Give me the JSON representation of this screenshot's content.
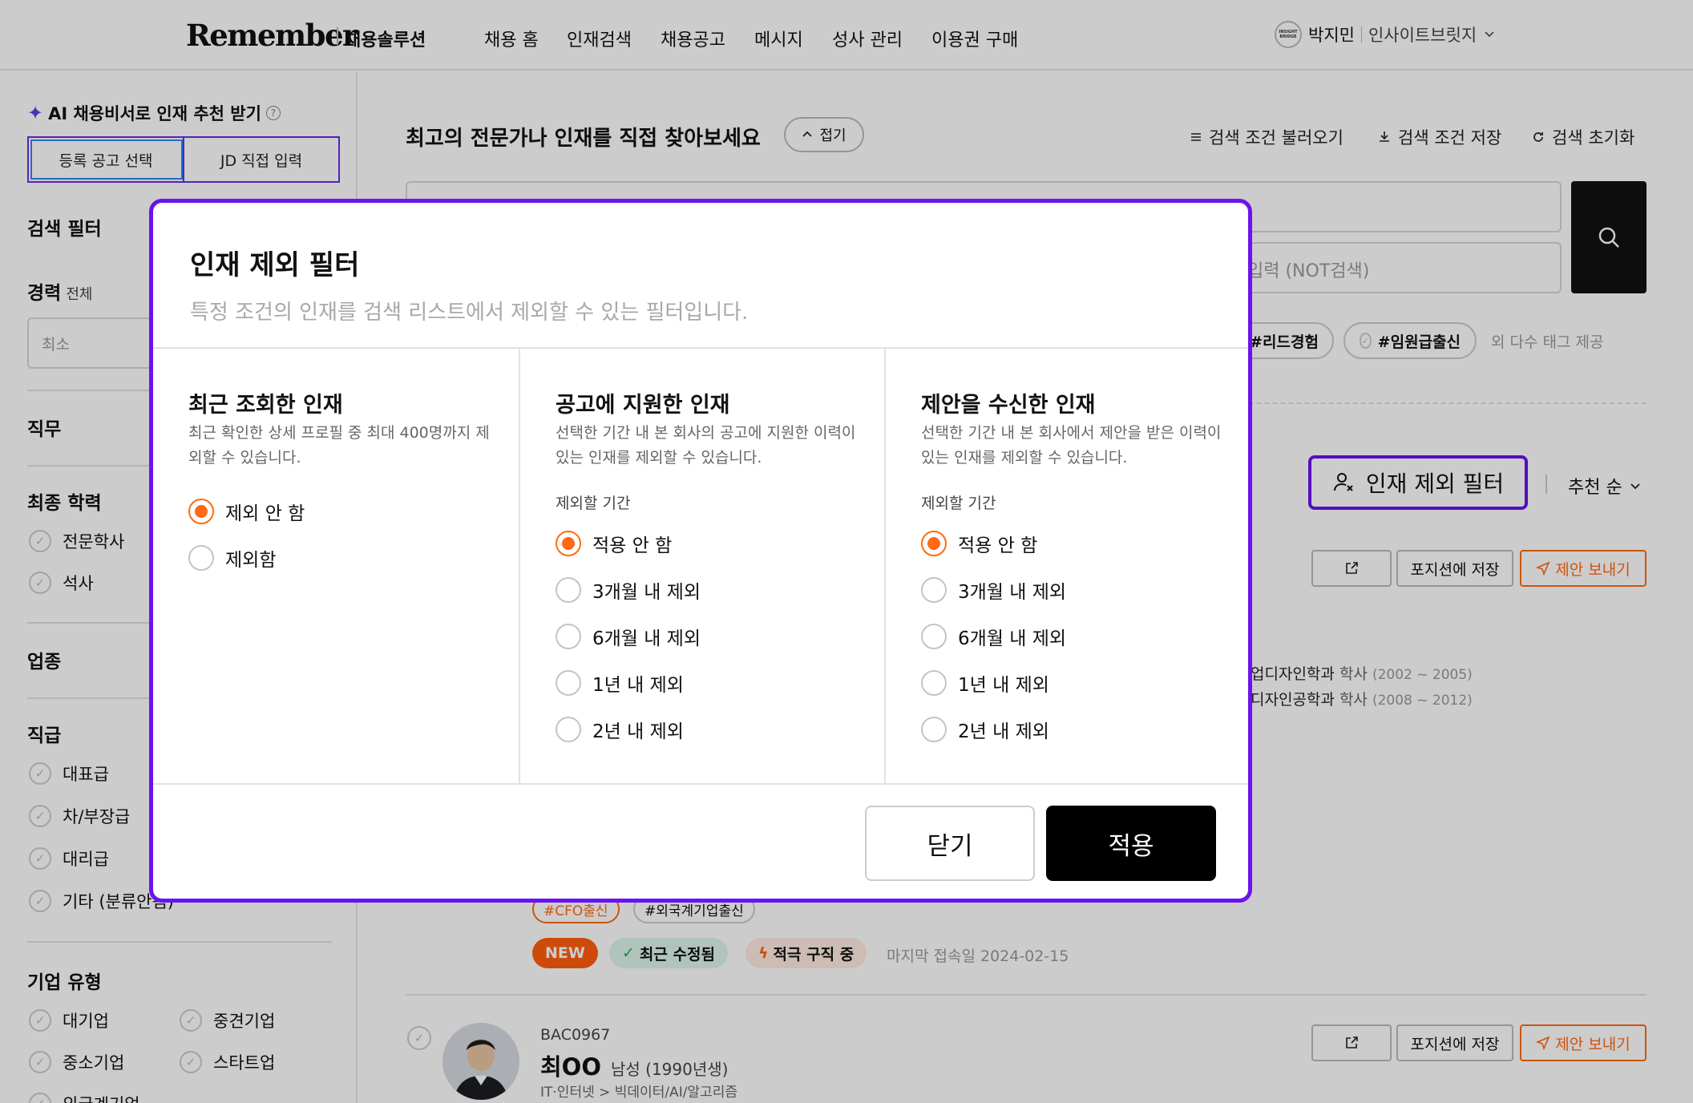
{
  "header": {
    "logo": "Remember",
    "logo_sub": "채용솔루션",
    "nav": [
      "채용 홈",
      "인재검색",
      "채용공고",
      "메시지",
      "성사 관리",
      "이용권 구매"
    ],
    "user_name": "박지민",
    "company": "인사이트브릿지",
    "avatar_text": "INSIGHT BRIDGE"
  },
  "sidebar": {
    "ai_title": "AI 채용비서로 인재 추천 받기",
    "ai_tabs": [
      "등록 공고 선택",
      "JD 직접 입력"
    ],
    "filter_title": "검색 필터",
    "career_label": "경력",
    "career_all": "전체",
    "career_min_placeholder": "최소",
    "job_label": "직무",
    "edu_label": "최종 학력",
    "edu_items": [
      "전문학사",
      "석사"
    ],
    "industry_label": "업종",
    "rank_label": "직급",
    "rank_items": [
      "대표급",
      "차/부장급",
      "대리급",
      "기타 (분류안됨)"
    ],
    "company_type_label": "기업 유형",
    "company_types": [
      "대기업",
      "중견기업",
      "중소기업",
      "스타트업",
      "외국계기업"
    ]
  },
  "main": {
    "title": "최고의 전문가나 인재를 직접 찾아보세요",
    "collapse_label": "접기",
    "utils": [
      "검색 조건 불러오기",
      "검색 조건 저장",
      "검색 초기화"
    ],
    "not_placeholder": "입력 (NOT검색)",
    "tags": [
      "#리드경험",
      "#임원급출신"
    ],
    "tag_more": "외 다수 태그 제공",
    "exclude_filter_label": "인재 제외 필터",
    "sort_label": "추천 순",
    "save_position_label": "포지션에 저장",
    "send_offer_label": "제안 보내기",
    "education": [
      {
        "school": "업디자인학과",
        "degree": "학사",
        "years": "(2002 ~ 2005)"
      },
      {
        "school": "디자인공학과",
        "degree": "학사",
        "years": "(2008 ~ 2012)"
      }
    ],
    "hash_tags": [
      "#CFO출신",
      "#외국계기업출신"
    ],
    "badges": {
      "new": "NEW",
      "updated": "최근 수정됨",
      "job_seeking": "적극 구직 중"
    },
    "last_login": "마지막 접속일 2024-02-15",
    "candidate": {
      "id": "BAC0967",
      "name": "최OO",
      "gender_birth": "남성 (1990년생)",
      "job": "IT·인터넷 > 빅데이터/AI/알고리즘"
    }
  },
  "modal": {
    "title": "인재 제외 필터",
    "description": "특정 조건의 인재를 검색 리스트에서 제외할 수 있는 필터입니다.",
    "columns": [
      {
        "title": "최근 조회한 인재",
        "desc": "최근 확인한 상세 프로필 중 최대 400명까지 제외할 수 있습니다.",
        "period_label": "",
        "options": [
          "제외 안 함",
          "제외함"
        ],
        "selected": 0
      },
      {
        "title": "공고에 지원한 인재",
        "desc": "선택한 기간 내 본 회사의 공고에 지원한 이력이 있는 인재를 제외할 수 있습니다.",
        "period_label": "제외할 기간",
        "options": [
          "적용 안 함",
          "3개월 내 제외",
          "6개월 내 제외",
          "1년 내 제외",
          "2년 내 제외"
        ],
        "selected": 0
      },
      {
        "title": "제안을 수신한 인재",
        "desc": "선택한 기간 내 본 회사에서 제안을 받은 이력이 있는 인재를 제외할 수 있습니다.",
        "period_label": "제외할 기간",
        "options": [
          "적용 안 함",
          "3개월 내 제외",
          "6개월 내 제외",
          "1년 내 제외",
          "2년 내 제외"
        ],
        "selected": 0
      }
    ],
    "close_label": "닫기",
    "apply_label": "적용"
  },
  "colors": {
    "accent_purple": "#6b12f0",
    "accent_orange": "#ff6a13",
    "primary_button": "#000000"
  }
}
